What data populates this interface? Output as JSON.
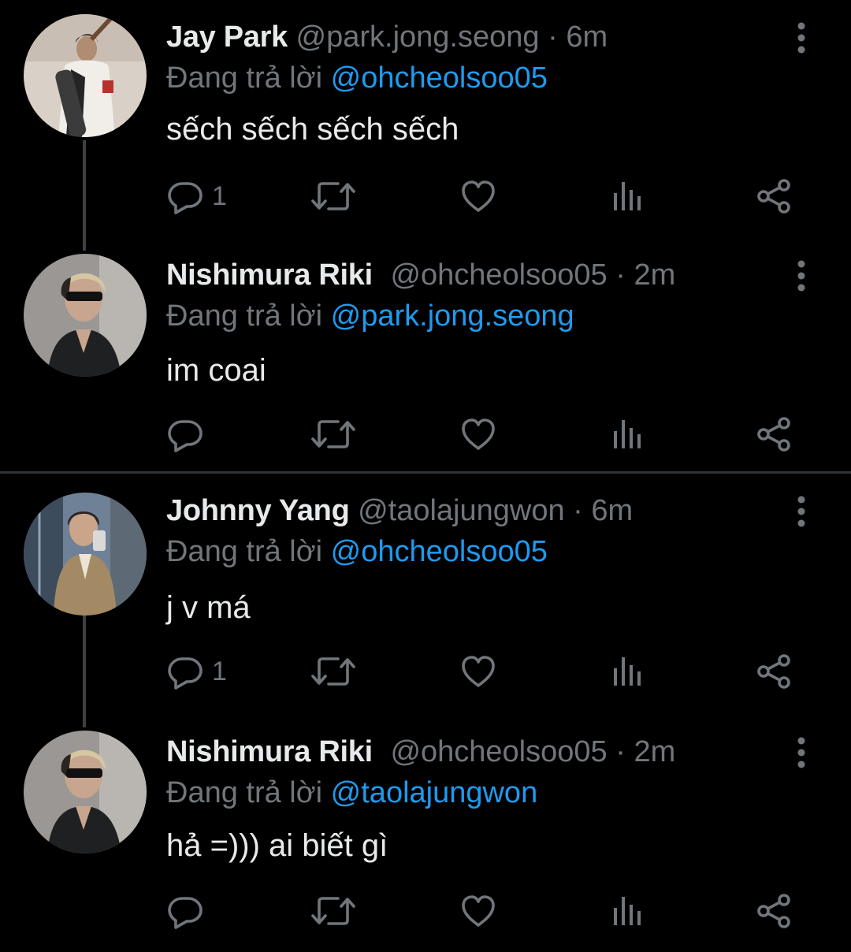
{
  "replying_prefix": "Đang trả lời",
  "colors": {
    "background": "#000000",
    "text": "#e7e9ea",
    "secondary": "#71767b",
    "accent": "#1d9bf0",
    "divider": "#2f3336"
  },
  "threads": [
    {
      "parent": {
        "name": "Jay Park",
        "handle": "@park.jong.seong",
        "separator": "·",
        "time": "6m",
        "reply_to": "@ohcheolsoo05",
        "text": "sếch sếch sếch sếch",
        "reply_count": "1",
        "icons": [
          "reply-icon",
          "retweet-icon",
          "like-icon",
          "views-icon",
          "share-icon",
          "more-icon"
        ]
      },
      "reply": {
        "name": "Nishimura Riki",
        "handle": "@ohcheolsoo05",
        "separator": "·",
        "time": "2m",
        "reply_to": "@park.jong.seong",
        "text": "im coai",
        "reply_count": ""
      }
    },
    {
      "parent": {
        "name": "Johnny Yang",
        "handle": "@taolajungwon",
        "separator": "·",
        "time": "6m",
        "reply_to": "@ohcheolsoo05",
        "text": "j v má",
        "reply_count": "1"
      },
      "reply": {
        "name": "Nishimura Riki",
        "handle": "@ohcheolsoo05",
        "separator": "·",
        "time": "2m",
        "reply_to": "@taolajungwon",
        "text": "hả =))) ai biết gì",
        "reply_count": ""
      }
    }
  ]
}
